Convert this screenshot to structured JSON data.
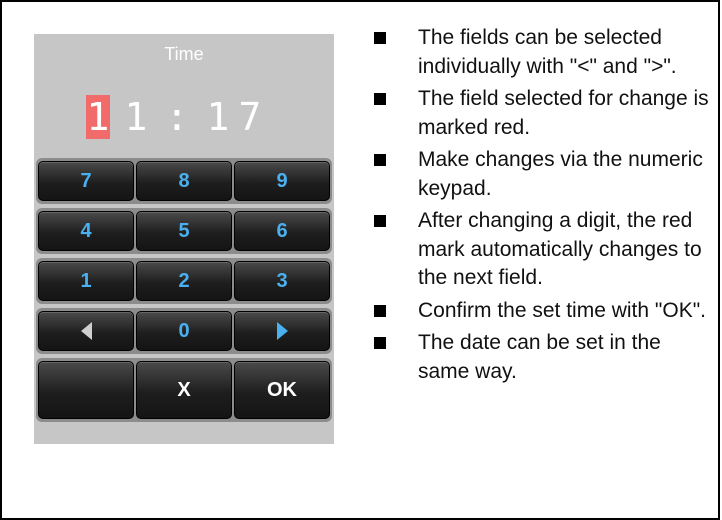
{
  "device": {
    "title": "Time",
    "time_digits": [
      "1",
      "1",
      "1",
      "7"
    ],
    "separator": ":",
    "selected_digit_index": 0,
    "colors": {
      "selected_highlight": "#f26b6b",
      "key_text": "#4ab0ef",
      "panel_bg": "#c6c6c6"
    },
    "keypad": {
      "rows": [
        [
          "7",
          "8",
          "9"
        ],
        [
          "4",
          "5",
          "6"
        ],
        [
          "1",
          "2",
          "3"
        ]
      ],
      "nav_row": {
        "left_icon": "left-arrow-icon",
        "middle": "0",
        "right_icon": "right-arrow-icon"
      },
      "action_row": {
        "left": "",
        "cancel": "X",
        "ok": "OK"
      }
    }
  },
  "instructions": [
    "The fields can be selected individually with \"<\" and \">\".",
    "The field selected for change is marked red.",
    "Make changes via the numeric keypad.",
    "After changing a digit, the red mark automatically changes to the next field.",
    "Confirm the set time with \"OK\".",
    "The date can be set in the same way."
  ]
}
